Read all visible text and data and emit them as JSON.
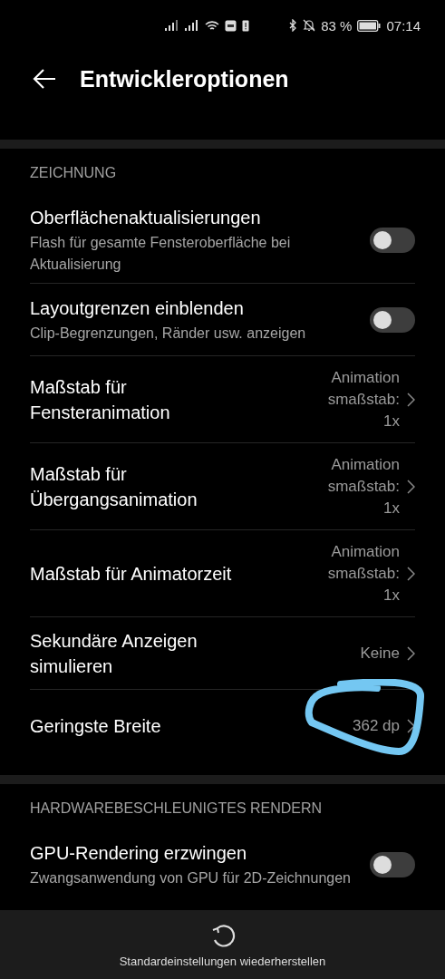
{
  "status_bar": {
    "battery": "83 %",
    "time": "07:14"
  },
  "header": {
    "title": "Entwickleroptionen"
  },
  "sections": [
    {
      "title": "ZEICHNUNG",
      "items": [
        {
          "kind": "toggle",
          "title": "Oberflächenaktualisierungen",
          "subtitle": "Flash für gesamte Fensteroberfläche bei Aktualisierung",
          "on": false
        },
        {
          "kind": "toggle",
          "title": "Layoutgrenzen einblenden",
          "subtitle": "Clip-Begrenzungen, Ränder usw. anzeigen",
          "on": false
        },
        {
          "kind": "value",
          "title": "Maßstab für Fensteranimation",
          "value": "Animationsmaßstab: 1x"
        },
        {
          "kind": "value",
          "title": "Maßstab für Übergangsanimation",
          "value": "Animationsmaßstab: 1x"
        },
        {
          "kind": "value",
          "title": "Maßstab für Animatorzeit",
          "value": "Animationsmaßstab: 1x"
        },
        {
          "kind": "value",
          "title": "Sekundäre Anzeigen simulieren",
          "value": "Keine"
        },
        {
          "kind": "value",
          "title": "Geringste Breite",
          "value": "362 dp",
          "circled": true
        }
      ]
    },
    {
      "title": "HARDWAREBESCHLEUNIGTES RENDERN",
      "items": [
        {
          "kind": "toggle",
          "title": "GPU-Rendering erzwingen",
          "subtitle": "Zwangsanwendung von GPU für 2D-Zeichnungen",
          "on": false
        }
      ]
    }
  ],
  "bottom_bar": {
    "label": "Standardeinstellungen wiederherstellen"
  }
}
